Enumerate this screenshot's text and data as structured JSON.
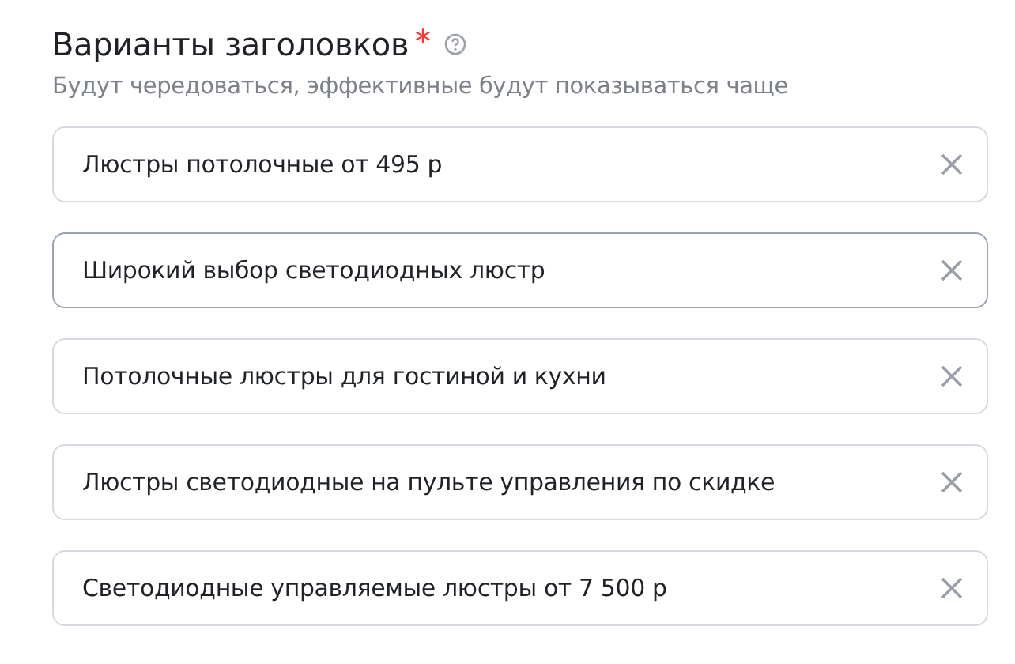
{
  "section": {
    "title": "Варианты заголовков",
    "required_mark": "*",
    "subtitle": "Будут чередоваться, эффективные будут показываться чаще"
  },
  "headlines": [
    {
      "value": "Люстры потолочные от 495 р",
      "hovered": false
    },
    {
      "value": "Широкий выбор светодиодных люстр",
      "hovered": true
    },
    {
      "value": "Потолочные люстры для гостиной и кухни",
      "hovered": false
    },
    {
      "value": "Люстры светодиодные на пульте управления по скидке",
      "hovered": false
    },
    {
      "value": "Светодиодные управляемые люстры от 7 500 р",
      "hovered": false
    }
  ]
}
